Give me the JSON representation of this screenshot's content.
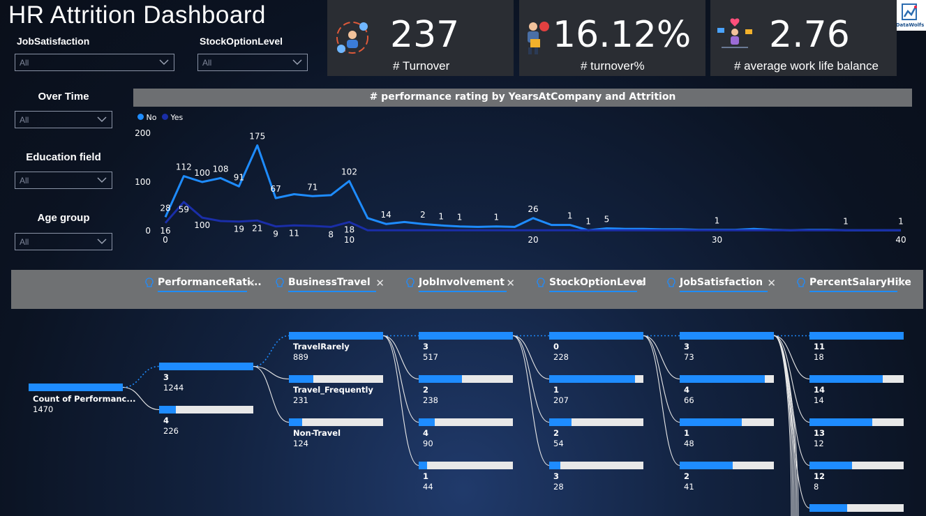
{
  "title": "HR Attrition Dashboard",
  "logo": {
    "text": "DataWolfs"
  },
  "slicers": [
    {
      "label": "JobSatisfaction",
      "value": "All"
    },
    {
      "label": "StockOptionLevel",
      "value": "All"
    },
    {
      "label": "Over Time",
      "value": "All"
    },
    {
      "label": "Education field",
      "value": "All"
    },
    {
      "label": "Age group",
      "value": "All"
    }
  ],
  "kpis": [
    {
      "value": "237",
      "label": "# Turnover",
      "icon": "people-network-icon"
    },
    {
      "value": "16.12%",
      "label": "# turnover%",
      "icon": "leaving-employee-icon"
    },
    {
      "value": "2.76",
      "label": "# average work life balance",
      "icon": "work-life-balance-icon"
    }
  ],
  "line_chart": {
    "header": "# performance rating by YearsAtCompany and Attrition",
    "legend": [
      {
        "name": "No",
        "color": "#1e8cff"
      },
      {
        "name": "Yes",
        "color": "#1a2ea8"
      }
    ],
    "y_ticks": [
      "200",
      "100",
      "0"
    ],
    "x_ticks": [
      "0",
      "10",
      "20",
      "30",
      "40"
    ]
  },
  "chart_data": {
    "type": "line",
    "xlim": [
      0,
      40
    ],
    "ylim": [
      0,
      200
    ],
    "series": [
      {
        "name": "No",
        "x": [
          0,
          1,
          2,
          3,
          4,
          5,
          6,
          7,
          8,
          9,
          10,
          11,
          12,
          13,
          14,
          15,
          16,
          17,
          18,
          19,
          20,
          21,
          22,
          23,
          24,
          25,
          26,
          27,
          28,
          29,
          30,
          31,
          32,
          33,
          34,
          35,
          36,
          37,
          38,
          39,
          40
        ],
        "values": [
          28,
          112,
          100,
          108,
          91,
          175,
          67,
          75,
          71,
          73,
          102,
          26,
          14,
          18,
          14,
          11,
          9,
          8,
          9,
          8,
          26,
          12,
          12,
          1,
          5,
          4,
          4,
          3,
          3,
          2,
          2,
          2,
          4,
          2,
          1,
          2,
          2,
          1,
          1,
          1,
          1
        ],
        "labels": {
          "0": "28",
          "1": "112",
          "2": "100",
          "3": "108",
          "4": "91",
          "5": "175",
          "6": "67",
          "8": "71",
          "10": "102",
          "12": "14",
          "14": "2",
          "15": "1",
          "16": "1",
          "18": "1",
          "20": "26",
          "22": "1",
          "23": "1",
          "24": "5",
          "30": "1",
          "37": "1",
          "40": "1"
        }
      },
      {
        "name": "Yes",
        "x": [
          0,
          1,
          2,
          3,
          4,
          5,
          6,
          7,
          8,
          9,
          10,
          11,
          12,
          13,
          14,
          15,
          16,
          17,
          18,
          19,
          20,
          21,
          22,
          23,
          24,
          25,
          26,
          27,
          28,
          29,
          30,
          31,
          32,
          33,
          34,
          35,
          36,
          37,
          38,
          39,
          40
        ],
        "values": [
          16,
          59,
          27,
          20,
          19,
          21,
          9,
          11,
          10,
          8,
          18,
          1,
          1,
          1,
          1,
          1,
          1,
          1,
          1,
          1,
          1,
          1,
          1,
          1,
          1,
          1,
          1,
          1,
          1,
          1,
          1,
          1,
          1,
          1,
          1,
          1,
          1,
          1,
          1,
          1,
          1
        ],
        "labels": {
          "0": "16",
          "1": "59",
          "2": "100",
          "4": "19",
          "5": "21",
          "6": "9",
          "7": "11",
          "9": "8",
          "10": "18"
        }
      }
    ]
  },
  "decomposition_tree": {
    "levels": [
      "PerformanceRati...",
      "BusinessTravel",
      "JobInvolvement",
      "StockOptionLevel",
      "JobSatisfaction",
      "PercentSalaryHike"
    ],
    "root": {
      "label": "Count of Performanc...",
      "value": "1470"
    },
    "performance_rating": [
      {
        "label": "3",
        "value": "1244",
        "frac": 1.0
      },
      {
        "label": "4",
        "value": "226",
        "frac": 0.18
      }
    ],
    "business_travel": [
      {
        "label": "TravelRarely",
        "value": "889",
        "frac": 1.0
      },
      {
        "label": "Travel_Frequently",
        "value": "231",
        "frac": 0.26
      },
      {
        "label": "Non-Travel",
        "value": "124",
        "frac": 0.14
      }
    ],
    "job_involvement": [
      {
        "label": "3",
        "value": "517",
        "frac": 1.0
      },
      {
        "label": "2",
        "value": "238",
        "frac": 0.46
      },
      {
        "label": "4",
        "value": "90",
        "frac": 0.17
      },
      {
        "label": "1",
        "value": "44",
        "frac": 0.09
      }
    ],
    "stock_option_level": [
      {
        "label": "0",
        "value": "228",
        "frac": 1.0
      },
      {
        "label": "1",
        "value": "207",
        "frac": 0.91
      },
      {
        "label": "2",
        "value": "54",
        "frac": 0.24
      },
      {
        "label": "3",
        "value": "28",
        "frac": 0.12
      }
    ],
    "job_satisfaction": [
      {
        "label": "3",
        "value": "73",
        "frac": 1.0
      },
      {
        "label": "4",
        "value": "66",
        "frac": 0.9
      },
      {
        "label": "1",
        "value": "48",
        "frac": 0.66
      },
      {
        "label": "2",
        "value": "41",
        "frac": 0.56
      }
    ],
    "percent_salary_hike": [
      {
        "label": "11",
        "value": "18",
        "frac": 1.0
      },
      {
        "label": "14",
        "value": "14",
        "frac": 0.78
      },
      {
        "label": "13",
        "value": "12",
        "frac": 0.67
      },
      {
        "label": "12",
        "value": "8",
        "frac": 0.45
      },
      {
        "label": "",
        "value": "",
        "frac": 0.4
      }
    ]
  }
}
